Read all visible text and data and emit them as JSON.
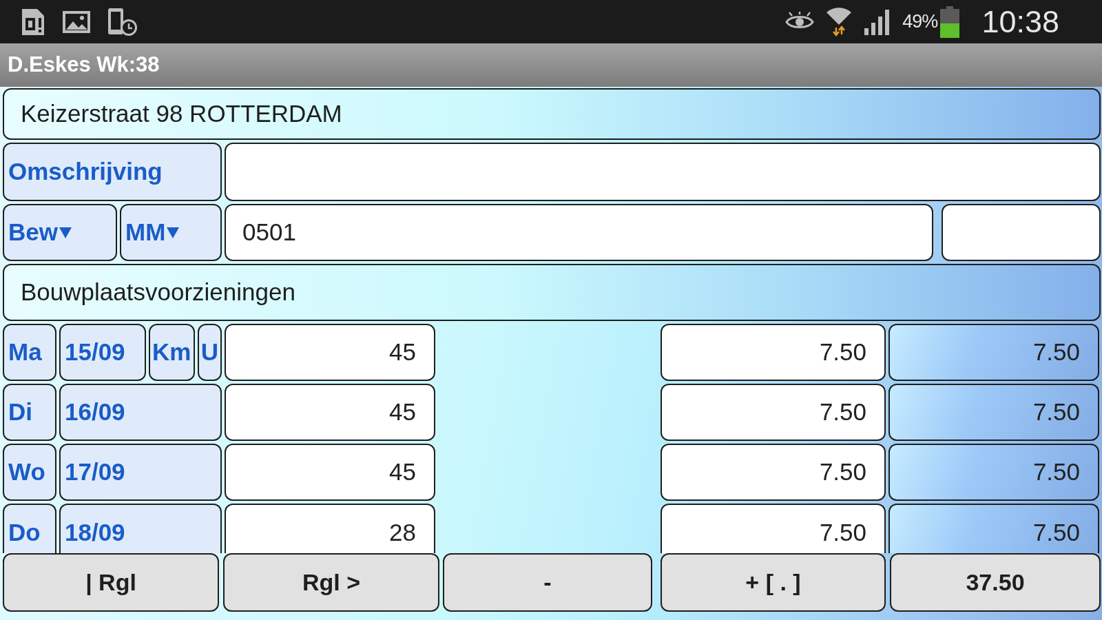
{
  "status_bar": {
    "battery_text": "49%",
    "time": "10:38"
  },
  "title": "D.Eskes Wk:38",
  "address": "Keizerstraat 98 ROTTERDAM",
  "description_field": {
    "label": "Omschrijving"
  },
  "selectors": [
    {
      "label": "Bew"
    },
    {
      "label": "MM"
    }
  ],
  "code_field": {
    "value": "0501"
  },
  "activity": "Bouwplaatsvoorzieningen",
  "days": [
    {
      "day": "Ma",
      "date": "15/09",
      "extras": [
        "Km",
        "U"
      ],
      "value": "45",
      "hours": "7.50",
      "total": "7.50"
    },
    {
      "day": "Di",
      "date": "16/09",
      "value": "45",
      "hours": "7.50",
      "total": "7.50"
    },
    {
      "day": "Wo",
      "date": "17/09",
      "value": "45",
      "hours": "7.50",
      "total": "7.50"
    },
    {
      "day": "Do",
      "date": "18/09",
      "value": "28",
      "hours": "7.50",
      "total": "7.50"
    }
  ],
  "buttons": [
    {
      "label": "| Rgl"
    },
    {
      "label": "Rgl >"
    },
    {
      "label": "-"
    },
    {
      "label": "+ [ . ]"
    },
    {
      "label": "37.50"
    }
  ]
}
